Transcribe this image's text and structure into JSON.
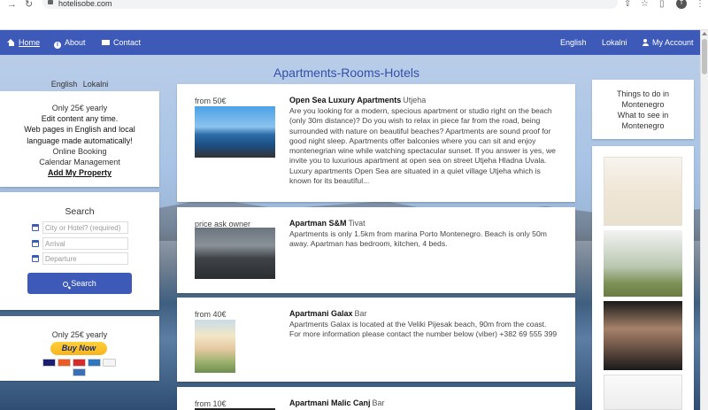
{
  "browser": {
    "url": "hotelisobe.com",
    "profile_initial": "T"
  },
  "nav": {
    "home": "Home",
    "about": "About",
    "contact": "Contact",
    "english": "English",
    "lokalni": "Lokalni",
    "account": "My Account"
  },
  "page_title": "Apartments-Rooms-Hotels",
  "left": {
    "lang_english": "English",
    "lang_lokalni": "Lokalni",
    "promo": {
      "line1": "Only 25€ yearly",
      "line2": "Edit content any time.",
      "line3": "Web pages in English and local",
      "line4": "language made automatically!",
      "line5": "Online Booking",
      "line6": "Calendar Management",
      "link": "Add My Property"
    },
    "search": {
      "title": "Search",
      "city_placeholder": "City or Hotel? (required)",
      "arrival_placeholder": "Arrival",
      "departure_placeholder": "Departure",
      "button": "Search"
    },
    "buy": {
      "price": "Only 25€ yearly",
      "button": "Buy Now"
    }
  },
  "listings": [
    {
      "price": "from 50€",
      "name": "Open Sea Luxury Apartments",
      "city": "Utjeha",
      "description": "Are you looking for a modern, specious apartment or studio right on the beach (only 30m distance)? Do you wish to relax in piece far from the road, being surrounded with nature on beautiful beaches? Apartments are sound proof for good night sleep. Apartments offer balconies where you can sit and enjoy montenegrian wine while watching spectacular sunset. If you answer is yes, we invite you to luxurious apartment at open sea on street Utjeha Hladna Uvala. Luxury apartments Open Sea are situated in a quiet village Utjeha which is known for its beautiful..."
    },
    {
      "price": "price ask owner",
      "name": "Apartman S&M",
      "city": "Tivat",
      "description": "Apartments is only 1.5km from marina Porto Montenegro. Beach is only 50m away. Apartman has bedroom, kitchen, 4 beds."
    },
    {
      "price": "from 40€",
      "name": "Apartmani Galax",
      "city": "Bar",
      "description": "Apartments Galax is located at the Veliki Pijesak beach, 90m from the coast. For more information please contact the number below (viber) +382 69 555 399"
    },
    {
      "price": "from 10€",
      "name": "Apartmani Malic Canj",
      "city": "Bar",
      "description": ""
    }
  ],
  "right": {
    "line1": "Things to do in",
    "line2": "Montenegro",
    "line3": "What to see in",
    "line4": "Montenegro"
  },
  "colors": {
    "nav_bg": "#3e5ab8",
    "title": "#3450a8",
    "buy_button": "#f7b31e"
  }
}
